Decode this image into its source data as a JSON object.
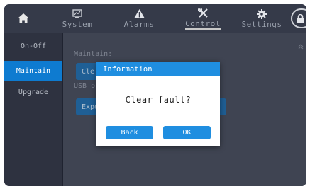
{
  "nav": {
    "home_icon": "home-icon",
    "tabs": [
      {
        "label": "System",
        "icon": "monitor-chart-icon"
      },
      {
        "label": "Alarms",
        "icon": "warning-icon"
      },
      {
        "label": "Control",
        "icon": "tools-icon"
      },
      {
        "label": "Settings",
        "icon": "gear-icon"
      }
    ],
    "active_tab": "Control",
    "lock_icon": "lock-icon"
  },
  "sidebar": {
    "items": [
      {
        "label": "On-Off"
      },
      {
        "label": "Maintain"
      },
      {
        "label": "Upgrade"
      }
    ],
    "active_item": "Maintain"
  },
  "main": {
    "maintain_label": "Maintain:",
    "clear_button_partial": "Cle",
    "usb_label": "USB o",
    "export_button_partial": "Expo",
    "collapse_icon": "double-chevron-up-icon"
  },
  "dialog": {
    "title": "Information",
    "message": "Clear fault?",
    "back_label": "Back",
    "ok_label": "OK"
  },
  "colors": {
    "accent": "#1f8ee0",
    "active_sidebar": "#0e7bd0",
    "background": "#2f3544"
  }
}
